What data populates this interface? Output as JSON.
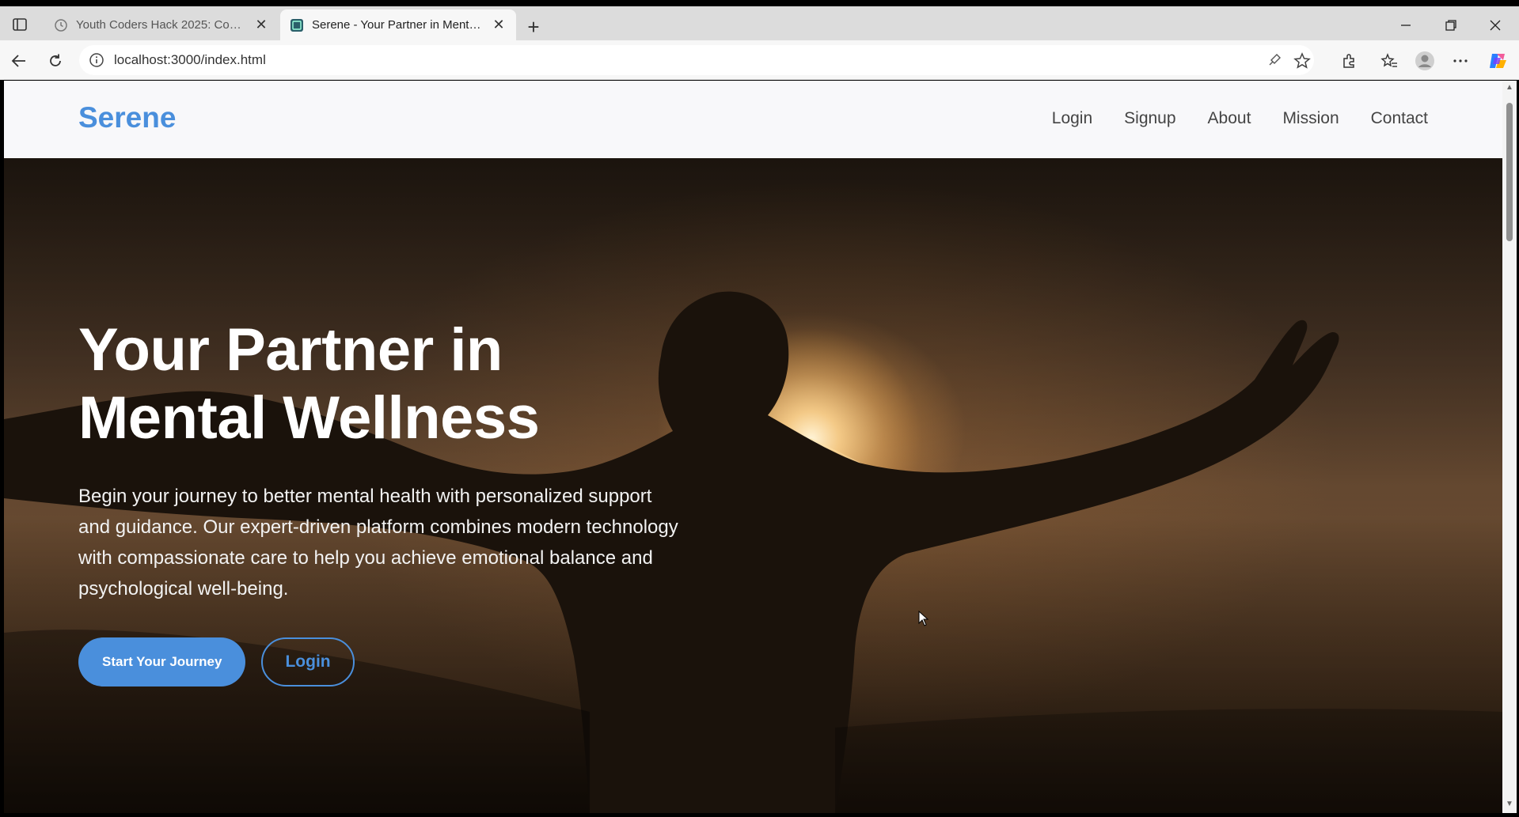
{
  "browser": {
    "tabs": [
      {
        "title": "Youth Coders Hack 2025: Connec",
        "active": false
      },
      {
        "title": "Serene - Your Partner in Mental W",
        "active": true
      }
    ],
    "url": "localhost:3000/index.html"
  },
  "site": {
    "brand": "Serene",
    "nav": [
      "Login",
      "Signup",
      "About",
      "Mission",
      "Contact"
    ],
    "hero": {
      "title_line1": "Your Partner in",
      "title_line2": "Mental Wellness",
      "text": "Begin your journey to better mental health with personalized support and guidance. Our expert-driven platform combines modern technology with compassionate care to help you achieve emotional balance and psychological well-being.",
      "primary_button": "Start Your Journey",
      "secondary_button": "Login"
    }
  },
  "colors": {
    "accent": "#4a8fdc",
    "nav_bg": "#f8f8fa",
    "hero_text": "#ffffff"
  },
  "icons": [
    "sidebar-toggle-icon",
    "tab-favicon-icon",
    "close-icon",
    "plus-icon",
    "minimize-icon",
    "restore-icon",
    "back-arrow-icon",
    "reload-icon",
    "info-icon",
    "read-aloud-icon",
    "star-icon",
    "extensions-icon",
    "favorites-icon",
    "profile-icon",
    "more-icon",
    "copilot-icon"
  ]
}
